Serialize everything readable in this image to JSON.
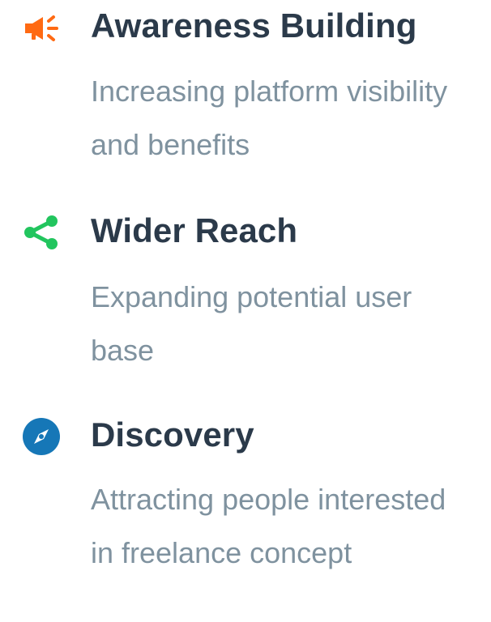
{
  "features": [
    {
      "title": "Awareness Building",
      "description": "Increasing platform visibility and benefits",
      "icon": "megaphone-icon",
      "icon_color": "#ff6a13"
    },
    {
      "title": "Wider Reach",
      "description": "Expanding potential user base",
      "icon": "share-icon",
      "icon_color": "#22c55e"
    },
    {
      "title": "Discovery",
      "description": "Attracting people interested in freelance concept",
      "icon": "compass-icon",
      "icon_color": "#1677b7"
    }
  ]
}
